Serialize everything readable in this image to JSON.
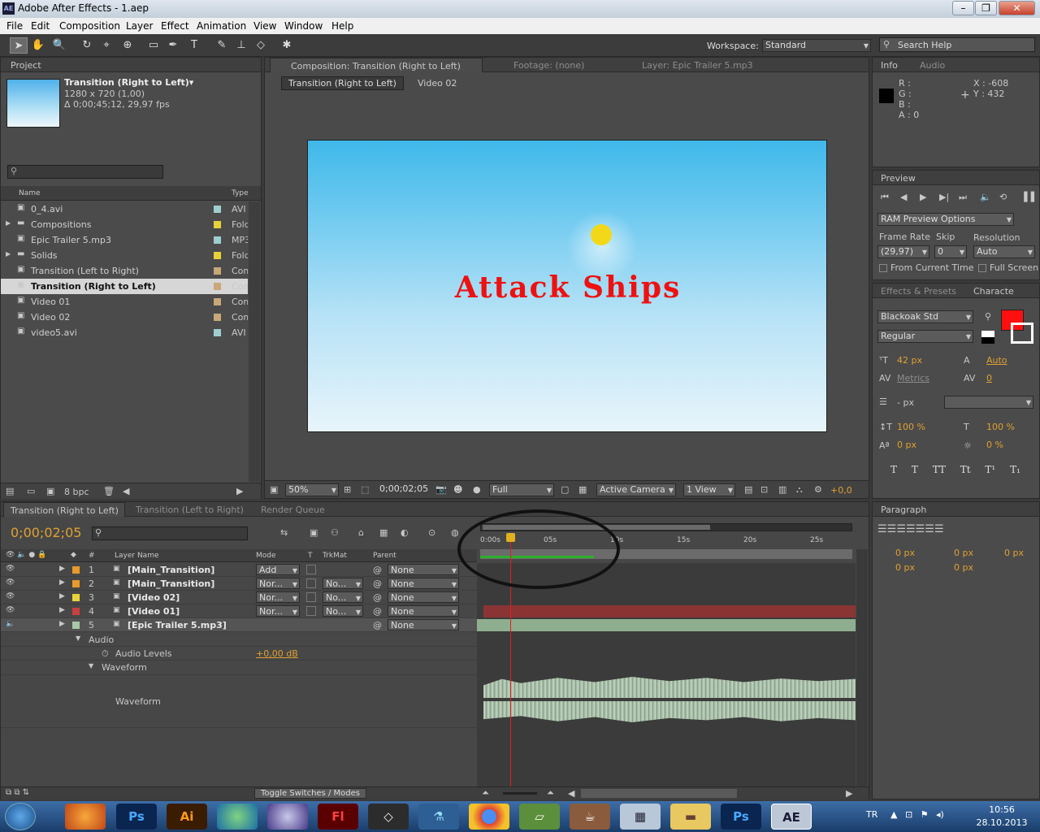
{
  "app": {
    "title": "Adobe After Effects - 1.aep",
    "icon": "AE"
  },
  "menu": [
    "File",
    "Edit",
    "Composition",
    "Layer",
    "Effect",
    "Animation",
    "View",
    "Window",
    "Help"
  ],
  "toolbar": {
    "workspace_label": "Workspace:",
    "workspace_value": "Standard",
    "search_placeholder": "Search Help"
  },
  "project": {
    "tab": "Project",
    "comp_name": "Transition (Right to Left)▾",
    "comp_size": "1280 x 720 (1,00)",
    "comp_duration": "Δ 0;00;45;12, 29,97 fps",
    "col_name": "Name",
    "col_type": "Type",
    "items": [
      {
        "name": "0_4.avi",
        "type": "AVI",
        "color": "#9ecfcf",
        "folder": false
      },
      {
        "name": "Compositions",
        "type": "Fold",
        "color": "#e8d23a",
        "folder": true
      },
      {
        "name": "Epic Trailer 5.mp3",
        "type": "MP3",
        "color": "#9ecfcf",
        "folder": false
      },
      {
        "name": "Solids",
        "type": "Fold",
        "color": "#e8d23a",
        "folder": true
      },
      {
        "name": "Transition (Left to Right)",
        "type": "Com",
        "color": "#c8a878",
        "folder": false
      },
      {
        "name": "Transition (Right to Left)",
        "type": "Com",
        "color": "#c8a878",
        "folder": false,
        "selected": true
      },
      {
        "name": "Video 01",
        "type": "Com",
        "color": "#c8a878",
        "folder": false
      },
      {
        "name": "Video 02",
        "type": "Com",
        "color": "#c8a878",
        "folder": false
      },
      {
        "name": "video5.avi",
        "type": "AVI",
        "color": "#9ecfcf",
        "folder": false
      }
    ],
    "bpc": "8 bpc"
  },
  "comp": {
    "tab": "Composition: Transition (Right to Left)",
    "footage_tab": "Footage: (none)",
    "layer_tab": "Layer: Epic Trailer 5.mp3",
    "crumb1": "Transition (Right to Left)",
    "crumb2": "Video 02",
    "title_text": "Attack Ships",
    "zoom": "50%",
    "timecode": "0;00;02;05",
    "quality": "Full",
    "camera": "Active Camera",
    "view": "1 View",
    "exposure": "+0,0"
  },
  "info": {
    "tab": "Info",
    "tab2": "Audio",
    "r": "R :",
    "g": "G :",
    "b": "B :",
    "a": "A : 0",
    "x": "X : -608",
    "y": "Y : 432"
  },
  "preview": {
    "tab": "Preview",
    "ram": "RAM Preview Options",
    "frame_rate_label": "Frame Rate",
    "skip_label": "Skip",
    "resolution_label": "Resolution",
    "frame_rate": "(29,97)",
    "skip": "0",
    "resolution": "Auto",
    "from_current": "From Current Time",
    "full_screen": "Full Screen"
  },
  "character": {
    "tab1": "Effects & Presets",
    "tab2": "Characte",
    "font": "Blackoak Std",
    "style": "Regular",
    "size": "42 px",
    "leading": "Auto",
    "kerning": "Metrics",
    "tracking": "0",
    "stroke": "- px",
    "vscale": "100 %",
    "hscale": "100 %",
    "baseline": "0 px",
    "tsume": "0 %",
    "fill_color": "#ff1010",
    "buttons": [
      "T",
      "T",
      "TT",
      "Tt",
      "T¹",
      "T₁"
    ]
  },
  "paragraph": {
    "tab": "Paragraph",
    "v1": "0 px",
    "v2": "0 px",
    "v3": "0 px",
    "v4": "0 px",
    "v5": "0 px"
  },
  "timeline": {
    "tabs": [
      "Transition (Right to Left)",
      "Transition (Left to Right)",
      "Render Queue"
    ],
    "timecode": "0;00;02;05",
    "cols": {
      "num": "#",
      "name": "Layer Name",
      "mode": "Mode",
      "t": "T",
      "trkmat": "TrkMat",
      "parent": "Parent"
    },
    "ruler": [
      "0:00s",
      "05s",
      "10s",
      "15s",
      "20s",
      "25s"
    ],
    "layers": [
      {
        "num": "1",
        "name": "[Main_Transition]",
        "mode": "Add",
        "trk": "",
        "parent": "None",
        "color": "#e89a2a"
      },
      {
        "num": "2",
        "name": "[Main_Transition]",
        "mode": "Nor...",
        "trk": "No...",
        "parent": "None",
        "color": "#e89a2a"
      },
      {
        "num": "3",
        "name": "[Video 02]",
        "mode": "Nor...",
        "trk": "No...",
        "parent": "None",
        "color": "#e8d23a"
      },
      {
        "num": "4",
        "name": "[Video 01]",
        "mode": "Nor...",
        "trk": "No...",
        "parent": "None",
        "color": "#c84040"
      },
      {
        "num": "5",
        "name": "[Epic Trailer 5.mp3]",
        "mode": "",
        "trk": "",
        "parent": "None",
        "color": "#a8c8a8"
      }
    ],
    "audio": "Audio",
    "audio_levels": "Audio Levels",
    "audio_levels_value": "+0,00 dB",
    "waveform": "Waveform",
    "waveform2": "Waveform",
    "toggle": "Toggle Switches / Modes"
  },
  "taskbar": {
    "lang": "TR",
    "time": "10:56",
    "date": "28.10.2013",
    "apps": [
      "Ps",
      "Ai",
      "Fl",
      "Ps",
      "AE"
    ]
  }
}
